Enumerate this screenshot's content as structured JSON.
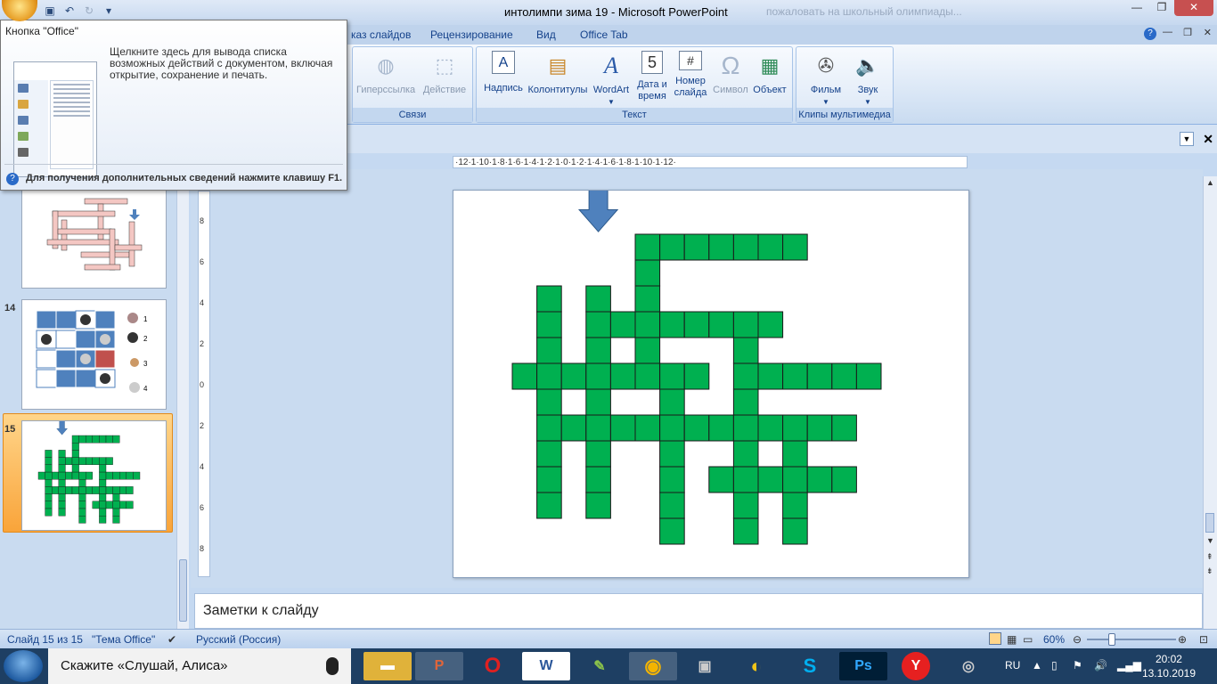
{
  "window": {
    "title": "интолимпи зима 19 - Microsoft PowerPoint",
    "ghost_title": "пожаловать на школьный олимпиады..."
  },
  "tabs": [
    {
      "label": "Показ слайдов",
      "visible": "каз слайдов"
    },
    {
      "label": "Рецензирование"
    },
    {
      "label": "Вид"
    },
    {
      "label": "Office Tab"
    }
  ],
  "ribbon": {
    "groups": {
      "links": {
        "label": "Связи",
        "buttons": [
          "Гиперссылка",
          "Действие"
        ]
      },
      "text": {
        "label": "Текст",
        "buttons": [
          "Надпись",
          "Колонтитулы",
          "WordArt",
          "Дата и время",
          "Номер слайда",
          "Символ",
          "Объект"
        ]
      },
      "media": {
        "label": "Клипы мультимедиа",
        "buttons": [
          "Фильм",
          "Звук"
        ]
      }
    },
    "labels": {
      "hyperlink": "Гиперссылка",
      "action": "Действие",
      "textbox": "Надпись",
      "header_footer": "Колонтитулы",
      "wordart": "WordArt",
      "datetime_1": "Дата и",
      "datetime_2": "время",
      "slide_number_1": "Номер",
      "slide_number_2": "слайда",
      "symbol": "Символ",
      "object": "Объект",
      "movie": "Фильм",
      "sound": "Звук"
    }
  },
  "tooltip": {
    "title": "Кнопка \"Office\"",
    "text": "Щелкните здесь для вывода списка возможных действий с документом, включая открытие, сохранение и печать.",
    "footer": "Для получения дополнительных сведений нажмите клавишу F1."
  },
  "slides_panel": {
    "slide_numbers": [
      "14",
      "15"
    ]
  },
  "ruler": {
    "h_text": "·12·1·10·1·8·1·6·1·4·1·2·1·0·1·2·1·4·1·6·1·8·1·10·1·12·"
  },
  "notes": {
    "placeholder": "Заметки к слайду"
  },
  "status": {
    "slide": "Слайд 15 из 15",
    "theme": "\"Тема Office\"",
    "language": "Русский (Россия)",
    "zoom": "60%"
  },
  "taskbar": {
    "search_text": "Скажите «Слушай, Алиса»",
    "lang": "RU",
    "time": "20:02",
    "date": "13.10.2019"
  },
  "colors": {
    "crossword_green": "#00b050",
    "arrow_blue": "#4f81bd",
    "ribbon_text": "#15428b"
  }
}
